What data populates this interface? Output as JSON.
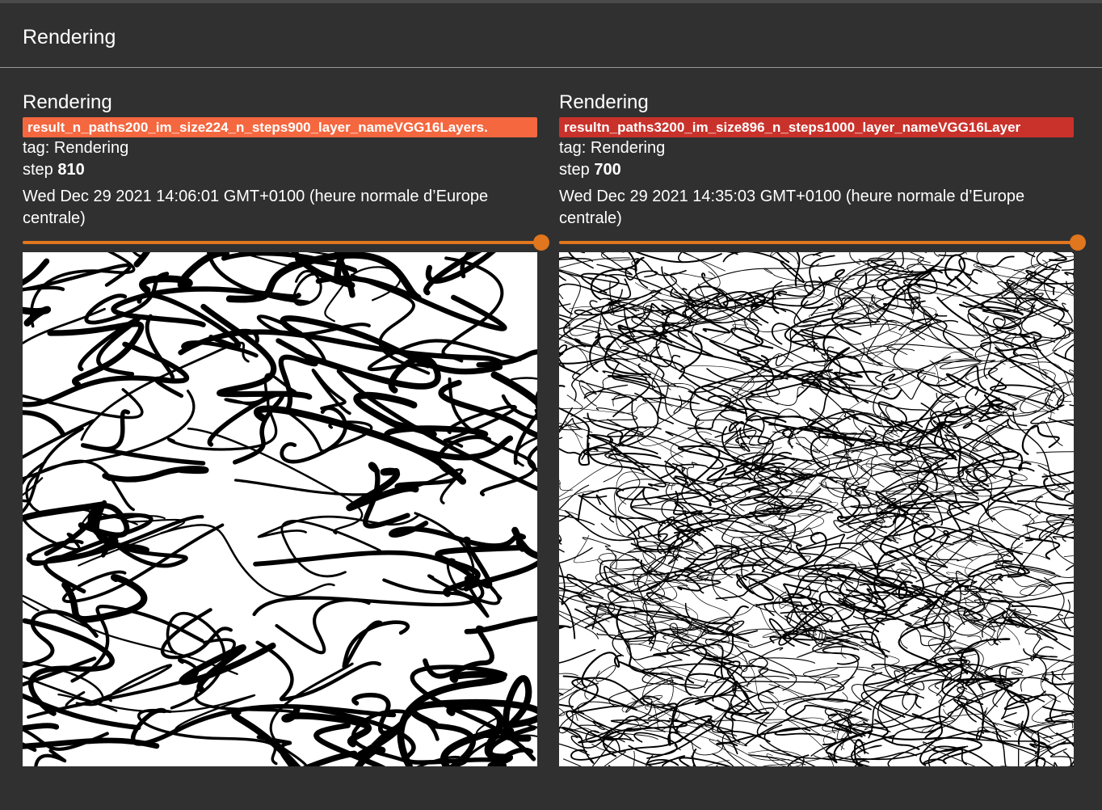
{
  "header": {
    "title": "Rendering"
  },
  "accent_color": "#e0761e",
  "cards": [
    {
      "title": "Rendering",
      "run": "result_n_paths200_im_size224_n_steps900_layer_nameVGG16Layers.",
      "run_color": "#f4673f",
      "tag_line": "tag: Rendering",
      "step_label": "step",
      "step_value": "810",
      "wall_time": "Wed Dec 29 2021 14:06:01 GMT+0100 (heure normale d’Europe centrale)",
      "slider_position": 1.0,
      "image": "coarse black-and-white ink line drawing rendering"
    },
    {
      "title": "Rendering",
      "run": "resultn_paths3200_im_size896_n_steps1000_layer_nameVGG16Layer",
      "run_color": "#c9322b",
      "tag_line": "tag: Rendering",
      "step_label": "step",
      "step_value": "700",
      "wall_time": "Wed Dec 29 2021 14:35:03 GMT+0100 (heure normale d’Europe centrale)",
      "slider_position": 1.0,
      "image": "dense black-and-white hatched line drawing rendering"
    }
  ]
}
